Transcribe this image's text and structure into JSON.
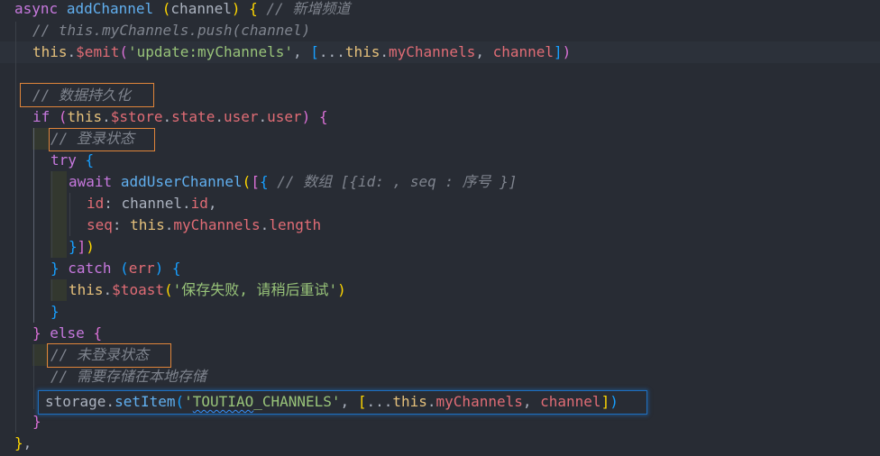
{
  "editor": {
    "lines": [
      {
        "id": "l01",
        "tokens": [
          [
            "k",
            "async"
          ],
          [
            "pn",
            " "
          ],
          [
            "f",
            "addChannel"
          ],
          [
            "pn",
            " "
          ],
          [
            "b1",
            "("
          ],
          [
            "pn",
            "channel"
          ],
          [
            "b1",
            ")"
          ],
          [
            "pn",
            " "
          ],
          [
            "b1",
            "{"
          ],
          [
            "pn",
            " "
          ],
          [
            "c",
            "// 新增频道"
          ]
        ]
      },
      {
        "id": "l02",
        "tokens": [
          [
            "c",
            "// this.myChannels.push(channel)"
          ]
        ]
      },
      {
        "id": "l03",
        "tokens": [
          [
            "t",
            "this"
          ],
          [
            "pn",
            "."
          ],
          [
            "p",
            "$emit"
          ],
          [
            "b2",
            "("
          ],
          [
            "s",
            "'update:myChannels'"
          ],
          [
            "pn",
            ", "
          ],
          [
            "b3",
            "["
          ],
          [
            "pn",
            "..."
          ],
          [
            "t",
            "this"
          ],
          [
            "pn",
            "."
          ],
          [
            "p",
            "myChannels"
          ],
          [
            "pn",
            ", "
          ],
          [
            "p",
            "channel"
          ],
          [
            "b3",
            "]"
          ],
          [
            "b2",
            ")"
          ]
        ]
      },
      {
        "id": "l04",
        "tokens": []
      },
      {
        "id": "l05",
        "tokens": [
          [
            "c",
            "// 数据持久化"
          ]
        ]
      },
      {
        "id": "l06",
        "tokens": [
          [
            "k",
            "if"
          ],
          [
            "pn",
            " "
          ],
          [
            "b2",
            "("
          ],
          [
            "t",
            "this"
          ],
          [
            "pn",
            "."
          ],
          [
            "p",
            "$store"
          ],
          [
            "pn",
            "."
          ],
          [
            "p",
            "state"
          ],
          [
            "pn",
            "."
          ],
          [
            "p",
            "user"
          ],
          [
            "pn",
            "."
          ],
          [
            "p",
            "user"
          ],
          [
            "b2",
            ")"
          ],
          [
            "pn",
            " "
          ],
          [
            "b2",
            "{"
          ]
        ]
      },
      {
        "id": "l07",
        "tokens": [
          [
            "c",
            "// 登录状态"
          ]
        ]
      },
      {
        "id": "l08",
        "tokens": [
          [
            "k",
            "try"
          ],
          [
            "pn",
            " "
          ],
          [
            "b3",
            "{"
          ]
        ]
      },
      {
        "id": "l09",
        "tokens": [
          [
            "k",
            "await"
          ],
          [
            "pn",
            " "
          ],
          [
            "f",
            "addUserChannel"
          ],
          [
            "b1",
            "("
          ],
          [
            "b2",
            "["
          ],
          [
            "b3",
            "{"
          ],
          [
            "pn",
            " "
          ],
          [
            "c",
            "// 数组 [{id: , seq : 序号 }]"
          ]
        ]
      },
      {
        "id": "l10",
        "tokens": [
          [
            "p",
            "id"
          ],
          [
            "pn",
            ": channel."
          ],
          [
            "p",
            "id"
          ],
          [
            "pn",
            ","
          ]
        ]
      },
      {
        "id": "l11",
        "tokens": [
          [
            "p",
            "seq"
          ],
          [
            "pn",
            ": "
          ],
          [
            "t",
            "this"
          ],
          [
            "pn",
            "."
          ],
          [
            "p",
            "myChannels"
          ],
          [
            "pn",
            "."
          ],
          [
            "p",
            "length"
          ]
        ]
      },
      {
        "id": "l12",
        "tokens": [
          [
            "b3",
            "}"
          ],
          [
            "b2",
            "]"
          ],
          [
            "b1",
            ")"
          ]
        ]
      },
      {
        "id": "l13",
        "tokens": [
          [
            "b3",
            "}"
          ],
          [
            "pn",
            " "
          ],
          [
            "k",
            "catch"
          ],
          [
            "pn",
            " "
          ],
          [
            "b3",
            "("
          ],
          [
            "p",
            "err"
          ],
          [
            "b3",
            ")"
          ],
          [
            "pn",
            " "
          ],
          [
            "b3",
            "{"
          ]
        ]
      },
      {
        "id": "l14",
        "tokens": [
          [
            "t",
            "this"
          ],
          [
            "pn",
            "."
          ],
          [
            "p",
            "$toast"
          ],
          [
            "b1",
            "("
          ],
          [
            "s",
            "'保存失败, 请稍后重试'"
          ],
          [
            "b1",
            ")"
          ]
        ]
      },
      {
        "id": "l15",
        "tokens": [
          [
            "b3",
            "}"
          ]
        ]
      },
      {
        "id": "l16",
        "tokens": [
          [
            "b2",
            "}"
          ],
          [
            "pn",
            " "
          ],
          [
            "k",
            "else"
          ],
          [
            "pn",
            " "
          ],
          [
            "b2",
            "{"
          ]
        ]
      },
      {
        "id": "l17",
        "tokens": [
          [
            "c",
            "// 未登录状态"
          ]
        ]
      },
      {
        "id": "l18",
        "tokens": [
          [
            "c",
            "// 需要存储在本地存储"
          ]
        ]
      },
      {
        "id": "l19",
        "tokens": [
          [
            "pn",
            "storage."
          ],
          [
            "f",
            "setItem"
          ],
          [
            "b3",
            "("
          ],
          [
            "s",
            "'"
          ],
          [
            "sq",
            "TOUTIAO"
          ],
          [
            "s",
            "_CHANNELS'"
          ],
          [
            "pn",
            ", "
          ],
          [
            "b1",
            "["
          ],
          [
            "pn",
            "..."
          ],
          [
            "t",
            "this"
          ],
          [
            "pn",
            "."
          ],
          [
            "p",
            "myChannels"
          ],
          [
            "pn",
            ", "
          ],
          [
            "p",
            "channel"
          ],
          [
            "b1",
            "]"
          ],
          [
            "b3",
            ")"
          ]
        ]
      },
      {
        "id": "l20",
        "tokens": [
          [
            "b2",
            "}"
          ]
        ]
      },
      {
        "id": "l21",
        "tokens": [
          [
            "b1",
            "}"
          ],
          [
            "pn",
            ","
          ]
        ]
      }
    ],
    "colors": {
      "background": "#282c34",
      "keyword": "#c678dd",
      "function": "#61afef",
      "property": "#e06c75",
      "string": "#98c379",
      "comment": "#7f848e",
      "this": "#e5c07b",
      "highlight_box": "#e0853a",
      "selection_box": "#1e6fc0"
    }
  }
}
